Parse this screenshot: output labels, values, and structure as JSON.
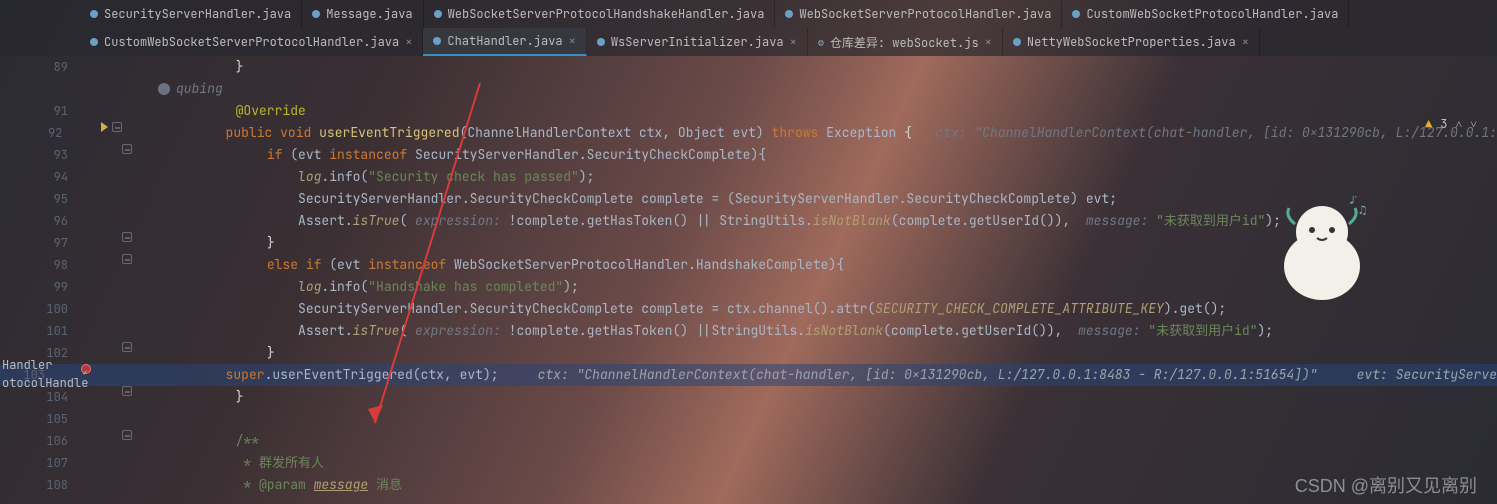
{
  "tabs_top": [
    {
      "label": "SecurityServerHandler.java",
      "active": false
    },
    {
      "label": "Message.java",
      "active": false
    },
    {
      "label": "WebSocketServerProtocolHandshakeHandler.java",
      "active": false
    },
    {
      "label": "WebSocketServerProtocolHandler.java",
      "active": false
    },
    {
      "label": "CustomWebSocketProtocolHandler.java",
      "active": false
    }
  ],
  "tabs_second": [
    {
      "label": "CustomWebSocketServerProtocolHandler.java",
      "active": false,
      "dot": "blue"
    },
    {
      "label": "ChatHandler.java",
      "active": true,
      "dot": "blue"
    },
    {
      "label": "WsServerInitializer.java",
      "active": false,
      "dot": "blue"
    },
    {
      "label": "仓库差异: webSocket.js",
      "active": false,
      "dot": "gear"
    },
    {
      "label": "NettyWebSocketProperties.java",
      "active": false,
      "dot": "blue"
    }
  ],
  "sidebar_fragment": [
    "Handler",
    "otocolHandle"
  ],
  "author": "qubing",
  "warnings": {
    "count": "3"
  },
  "watermark": "CSDN @离别又见离别",
  "lines": {
    "89": {
      "indent": "            ",
      "brace": "}"
    },
    "91": {
      "indent": "            ",
      "anno": "@Override"
    },
    "92": {
      "indent": "            ",
      "kw1": "public void ",
      "mtd": "userEventTriggered",
      "sig": "(ChannelHandlerContext ctx, Object evt) ",
      "kw2": "throws ",
      "exc": "Exception ",
      "brace": "{",
      "ghost": "   ctx: \"ChannelHandlerContext(chat-handler, [id: 0x131290cb, L:/127.0.0.1:"
    },
    "93": {
      "indent": "                ",
      "kw": "if ",
      "paren": "(evt ",
      "kw2": "instanceof ",
      "rest": "SecurityServerHandler.SecurityCheckComplete){"
    },
    "94": {
      "indent": "                    ",
      "log": "log",
      "dot": ".info(",
      "str": "\"Security check has passed\"",
      "end": ");"
    },
    "95": {
      "indent": "                    ",
      "txt": "SecurityServerHandler.SecurityCheckComplete complete = (SecurityServerHandler.SecurityCheckComplete) evt;"
    },
    "96": {
      "indent": "                    ",
      "pre": "Assert.",
      "it": "isTrue",
      "open": "( ",
      "gh": "expression: ",
      "mid": "!complete.getHasToken() || StringUtils.",
      "it2": "isNotBlank",
      "mid2": "(complete.getUserId()), ",
      "gh2": " message: ",
      "str": "\"未获取到用户id\"",
      "end": ");"
    },
    "97": {
      "indent": "                ",
      "brace": "}"
    },
    "98": {
      "indent": "                ",
      "kw": "else if ",
      "paren": "(evt ",
      "kw2": "instanceof ",
      "rest": "WebSocketServerProtocolHandler.HandshakeComplete){"
    },
    "99": {
      "indent": "                    ",
      "log": "log",
      "dot": ".info(",
      "str": "\"Handshake has completed\"",
      "end": ");"
    },
    "100": {
      "indent": "                    ",
      "pre": "SecurityServerHandler.SecurityCheckComplete complete = ctx.channel().attr(",
      "it": "SECURITY_CHECK_COMPLETE_ATTRIBUTE_KEY",
      "post": ").get();"
    },
    "101": {
      "indent": "                    ",
      "pre": "Assert.",
      "it": "isTrue",
      "open": "( ",
      "gh": "expression: ",
      "mid": "!complete.getHasToken() ||StringUtils.",
      "it2": "isNotBlank",
      "mid2": "(complete.getUserId()), ",
      "gh2": " message: ",
      "str": "\"未获取到用户id\"",
      "end": ");"
    },
    "102": {
      "indent": "                ",
      "brace": "}"
    },
    "103": {
      "indent": "                ",
      "kw": "super",
      "mtd": ".userEventTriggered(ctx, evt);",
      "ghost": "     ctx: \"ChannelHandlerContext(chat-handler, [id: 0x131290cb, L:/127.0.0.1:8483 - R:/127.0.0.1:51654])\"",
      "ghost2": "     evt: SecurityServe"
    },
    "104": {
      "indent": "            ",
      "brace": "}"
    },
    "106": {
      "indent": "            ",
      "c": "/**"
    },
    "107": {
      "indent": "             ",
      "c": "* 群发所有人"
    },
    "108": {
      "indent": "             ",
      "c": "* @param ",
      "p": "message",
      "c2": " 消息"
    }
  }
}
